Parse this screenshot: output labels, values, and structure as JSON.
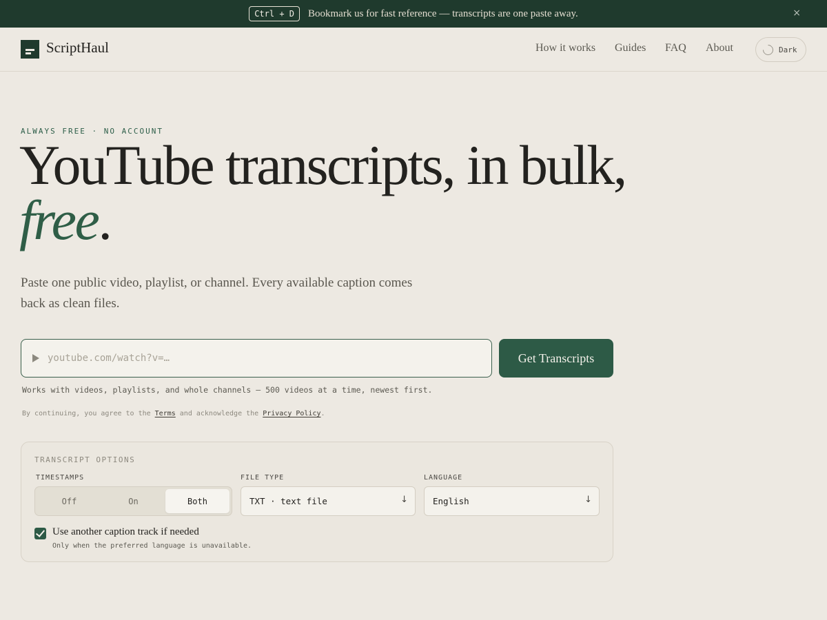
{
  "banner": {
    "shortcut": "Ctrl + D",
    "text": "Bookmark us for fast reference — transcripts are one paste away.",
    "close_glyph": "×"
  },
  "header": {
    "brand": "ScriptHaul",
    "nav": [
      "How it works",
      "Guides",
      "FAQ",
      "About"
    ],
    "theme_toggle_label": "Dark"
  },
  "hero": {
    "eyebrow": "ALWAYS FREE · NO ACCOUNT",
    "headline_part1": "YouTube transcripts, in bulk, ",
    "headline_emphasis": "free",
    "headline_end": ".",
    "lede": "Paste one public video, playlist, or channel. Every available caption comes back as clean files."
  },
  "input": {
    "placeholder": "youtube.com/watch?v=…",
    "value": "",
    "submit_label": "Get Transcripts",
    "hint": "Works with videos, playlists, and whole channels — 500 videos at a time, newest first."
  },
  "legal": {
    "prefix": "By continuing, you agree to the ",
    "terms": "Terms",
    "middle": " and acknowledge the ",
    "privacy": "Privacy Policy",
    "suffix": "."
  },
  "options": {
    "title": "TRANSCRIPT OPTIONS",
    "timestamps_label": "TIMESTAMPS",
    "timestamps_options": [
      "Off",
      "On",
      "Both"
    ],
    "timestamps_selected": "Both",
    "filetype_label": "FILE TYPE",
    "filetype_value": "TXT · text file",
    "language_label": "LANGUAGE",
    "language_value": "English",
    "select_arrow": "↓",
    "fallback_checked": true,
    "fallback_label": "Use another caption track if needed",
    "fallback_sub": "Only when the preferred language is unavailable."
  },
  "colors": {
    "banner_bg": "#1f3a2d",
    "accent": "#2d5a46",
    "page_bg": "#ede9e2"
  }
}
